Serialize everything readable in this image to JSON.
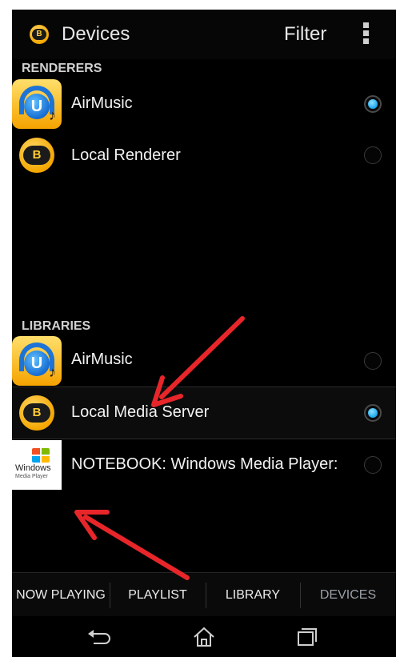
{
  "app": {
    "title": "Devices",
    "filter_label": "Filter",
    "logo_text": "B"
  },
  "renderers": {
    "header": "RENDERERS",
    "items": [
      {
        "label": "AirMusic",
        "icon": "airmusic-icon",
        "selected": true
      },
      {
        "label": "Local Renderer",
        "icon": "bubbleupnp-icon",
        "selected": false
      }
    ]
  },
  "libraries": {
    "header": "LIBRARIES",
    "items": [
      {
        "label": "AirMusic",
        "icon": "airmusic-icon",
        "selected": false
      },
      {
        "label": "Local Media Server",
        "icon": "bubbleupnp-icon",
        "selected": true
      },
      {
        "label": "NOTEBOOK: Windows Media Player:",
        "icon": "windows-media-player-icon",
        "selected": false
      }
    ]
  },
  "icon_text": {
    "airmusic_letter": "U",
    "note": "♪",
    "b_logo": "B",
    "wmp_word": "Windows",
    "wmp_sub": "Media Player"
  },
  "tabs": [
    {
      "label": "NOW PLAYING",
      "active": false
    },
    {
      "label": "PLAYLIST",
      "active": false
    },
    {
      "label": "LIBRARY",
      "active": false
    },
    {
      "label": "DEVICES",
      "active": true
    }
  ],
  "nav": [
    "back-icon",
    "home-icon",
    "recents-icon"
  ],
  "colors": {
    "background": "#000000",
    "radio_selected": "#1aa6ee",
    "annotation_arrow": "#e8262a",
    "active_tab": "#9aa0a8"
  }
}
